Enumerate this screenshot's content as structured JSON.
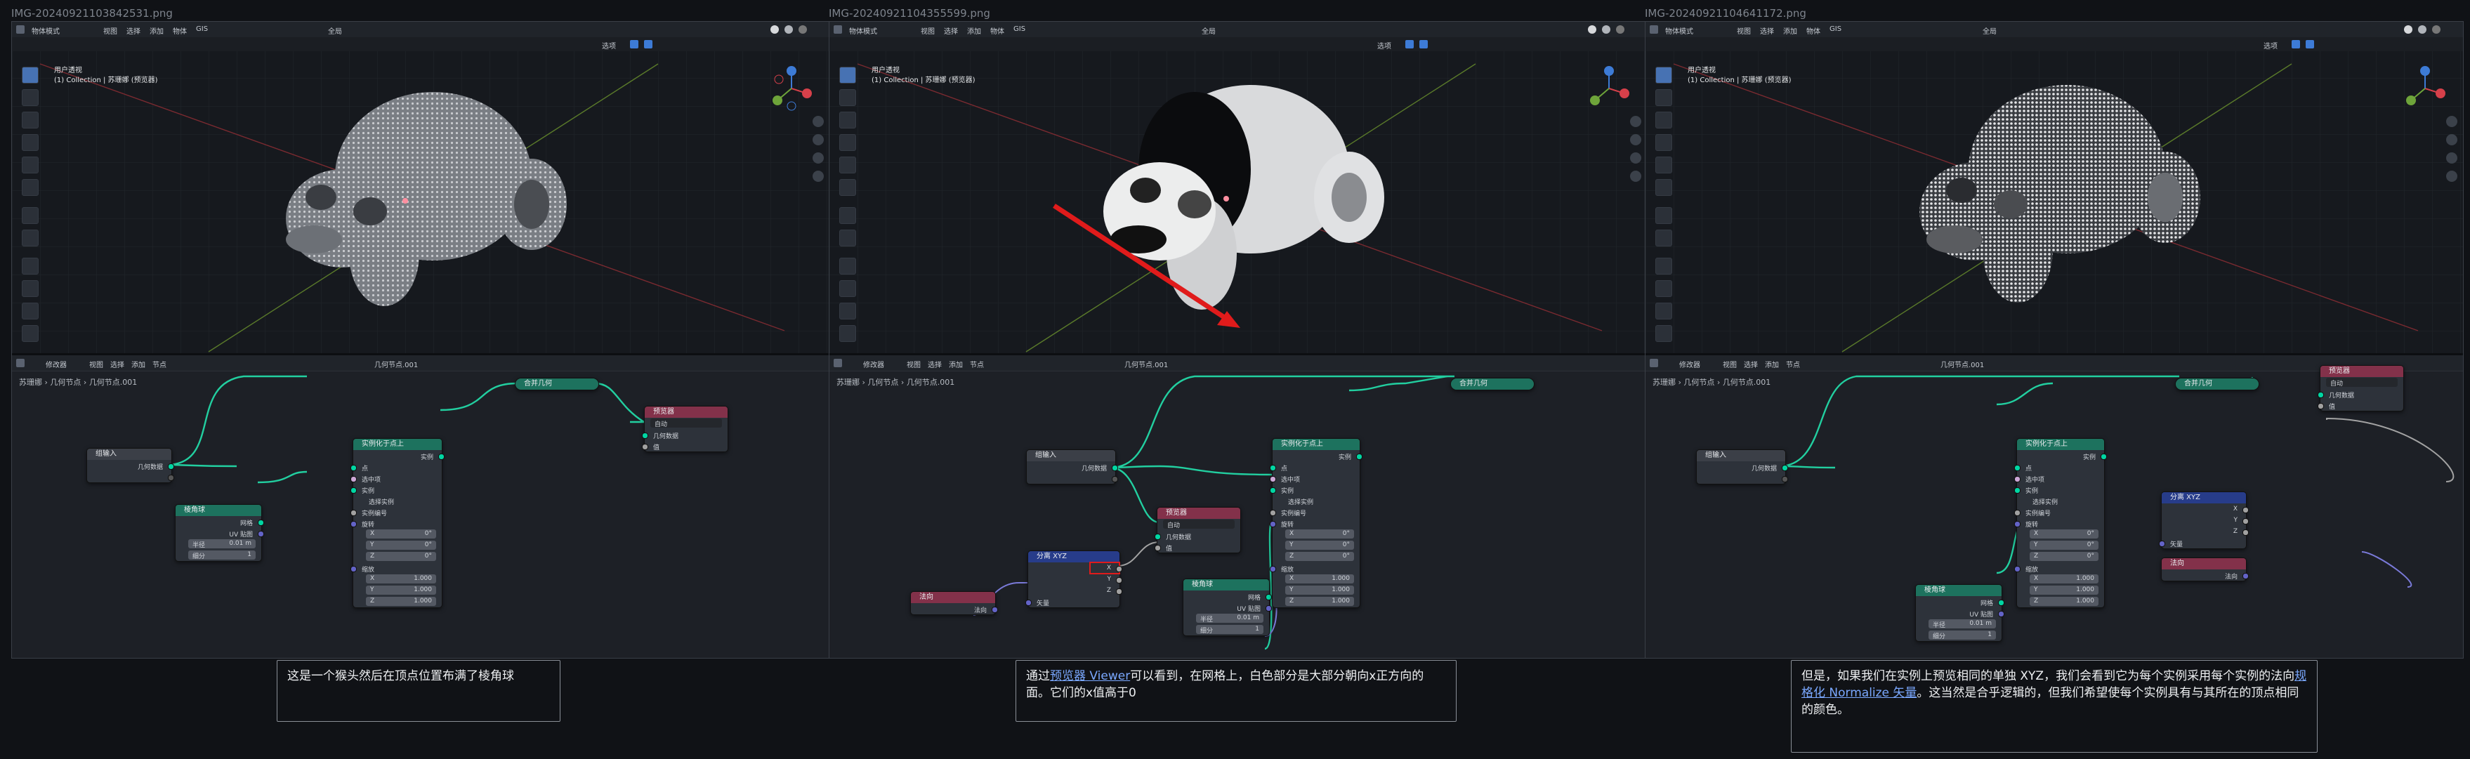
{
  "filenames": [
    "IMG-20240921103842531.png",
    "IMG-20240921104355599.png",
    "IMG-20240921104641172.png"
  ],
  "viewport": {
    "mode_menu": "物体模式",
    "menus": [
      "视图",
      "选择",
      "添加",
      "物体",
      "GIS"
    ],
    "transform": "全局",
    "options": "选项",
    "view_name": "用户透视",
    "collection": "(1) Collection | 苏珊娜 (预览器)"
  },
  "editor": {
    "type": "修改器",
    "menus": [
      "视图",
      "选择",
      "添加",
      "节点"
    ],
    "tree_name": "几何节点.001",
    "breadcrumb": [
      "苏珊娜",
      "几何节点",
      "几何节点.001"
    ]
  },
  "nodes": {
    "group_input": {
      "title": "组输入",
      "geometry": "几何数据"
    },
    "instance_on_points": {
      "title": "实例化于点上",
      "instances": "实例",
      "points": "点",
      "selection": "选中项",
      "instance": "实例",
      "pick_instance": "选择实例",
      "instance_index": "实例编号",
      "rotation": "旋转",
      "x": "X",
      "y": "Y",
      "z": "Z",
      "rot_x": "0°",
      "rot_y": "0°",
      "rot_z": "0°",
      "scale": "缩放",
      "sx": "1.000",
      "sy": "1.000",
      "sz": "1.000"
    },
    "realize": {
      "title": "合并几何"
    },
    "viewer": {
      "title": "预览器",
      "mode": "自动",
      "geometry": "几何数据",
      "value": "值"
    },
    "ico_sphere": {
      "title": "棱角球",
      "mesh": "网格",
      "uv": "UV 贴图",
      "radius_label": "半径",
      "radius": "0.01 m",
      "subdiv_label": "细分",
      "subdiv": "1"
    },
    "separate_xyz": {
      "title": "分离 XYZ",
      "x": "X",
      "y": "Y",
      "z": "Z",
      "vector": "矢量"
    },
    "normal": {
      "title": "法向",
      "output": "法向"
    }
  },
  "captions": [
    {
      "text": "这是一个猴头然后在顶点位置布满了棱角球"
    },
    {
      "pre": "通过",
      "link": "预览器 Viewer",
      "post": "可以看到，在网格上，白色部分是大部分朝向x正方向的面。它们的x值高于0"
    },
    {
      "pre": "但是，如果我们在实例上预览相同的单独 XYZ，我们会看到它为每个实例采用每个实例的法向",
      "link": "规格化 Normalize 矢量",
      "post": "。这当然是合乎逻辑的，但我们希望使每个实例具有与其所在的顶点相同的颜色。"
    }
  ],
  "colors": {
    "geometry_socket": "#00d6a3",
    "vector_socket": "#6363c7",
    "float_socket": "#a1a1a1",
    "viewer_header": "#83314a",
    "geometry_header": "#1d725e",
    "converter_header": "#273c8a",
    "arrow": "#e01b1b"
  }
}
